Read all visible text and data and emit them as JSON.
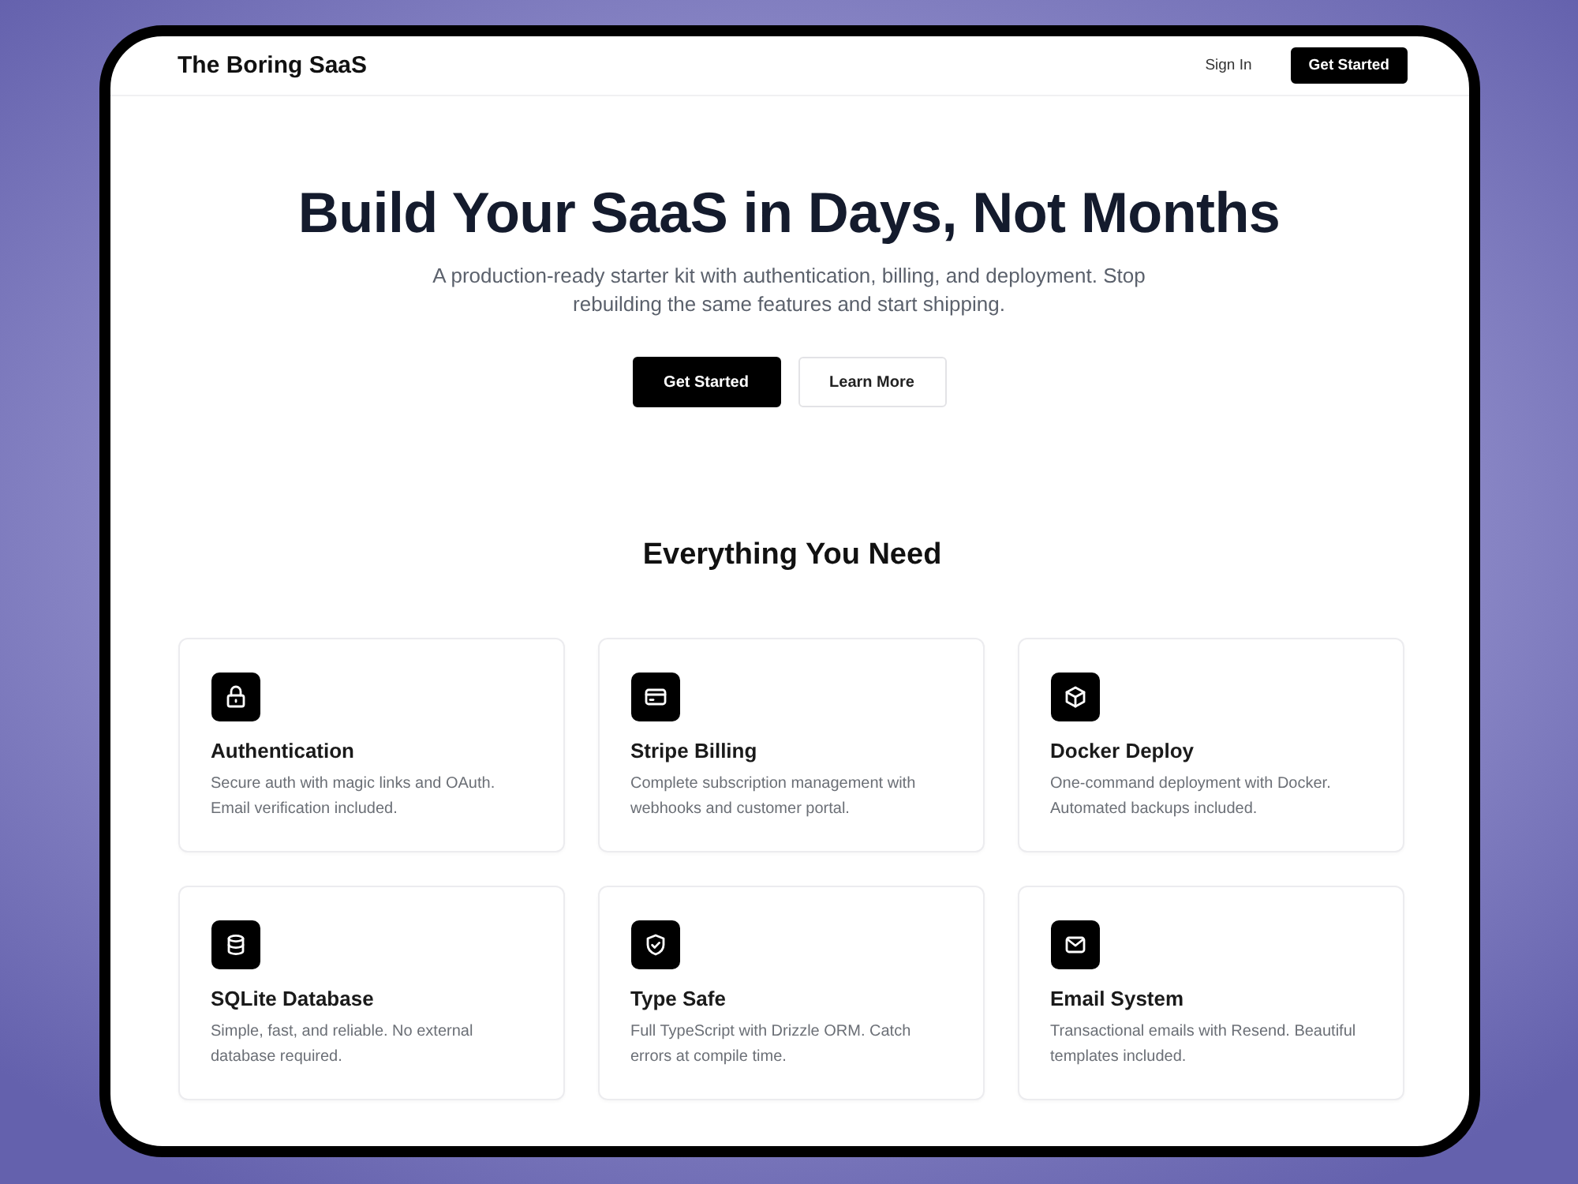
{
  "nav": {
    "logo": "The Boring SaaS",
    "actions": [
      {
        "label": "Sign In",
        "kind": "link"
      },
      {
        "label": "Get Started",
        "kind": "primary"
      }
    ]
  },
  "hero": {
    "title": "Build Your SaaS in Days, Not Months",
    "subtitle": "A production-ready starter kit with authentication, billing, and deployment. Stop rebuilding the same features and start shipping.",
    "buttons": [
      {
        "label": "Get Started",
        "kind": "primary"
      },
      {
        "label": "Learn More",
        "kind": "outline"
      }
    ]
  },
  "features": {
    "heading": "Everything You Need",
    "items": [
      {
        "title": "Authentication",
        "description": "Secure auth with magic links and OAuth. Email verification included."
      },
      {
        "title": "Stripe Billing",
        "description": "Complete subscription management with webhooks and customer portal."
      },
      {
        "title": "Docker Deploy",
        "description": "One-command deployment with Docker. Automated backups included."
      },
      {
        "title": "SQLite Database",
        "description": "Simple, fast, and reliable. No external database required."
      },
      {
        "title": "Type Safe",
        "description": "Full TypeScript with Drizzle ORM. Catch errors at compile time."
      },
      {
        "title": "Email System",
        "description": "Transactional emails with Resend. Beautiful templates included."
      }
    ]
  }
}
